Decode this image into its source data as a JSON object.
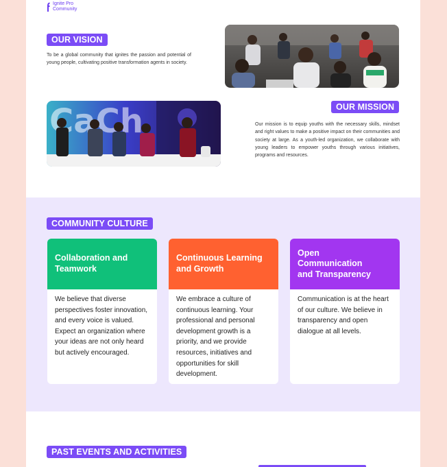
{
  "brand": {
    "line1": "Ignite Pro",
    "line2": "Community",
    "color": "#6b3df0"
  },
  "vision": {
    "label": "OUR VISION",
    "text": "To be a global community that ignites the passion and potential of young people, cultivating positive transformation agents in society."
  },
  "mission": {
    "label": "OUR MISSION",
    "text": "Our mission is to equip youths with the necessary skills, mindset and right values to make a positive impact on their communities and society at large. As a youth-led organization, we collaborate with young leaders to empower youths through various initiatives, programs and resources."
  },
  "culture": {
    "label": "COMMUNITY CULTURE",
    "cards": [
      {
        "title": "Collaboration and Teamwork",
        "body": "We believe that diverse perspectives foster innovation, and every voice is valued. Expect an organization where your ideas are not only heard but actively encouraged.",
        "color": "#10c07a"
      },
      {
        "title": "Continuous Learning and Growth",
        "body": "We embrace a culture of continuous learning. Your professional and personal development growth is a priority, and we provide resources, initiatives and opportunities for skill development.",
        "color": "#ff6130"
      },
      {
        "title": "Open Communication and Transparency",
        "body": "Communication is at the heart of our culture. We believe in transparency and open dialogue at all levels.",
        "color": "#a236f0"
      }
    ]
  },
  "events": {
    "label": "PAST EVENTS AND ACTIVITIES"
  },
  "colors": {
    "accent": "#7b4cf6",
    "band": "#ede7fd",
    "outer": "#fbe0d8"
  }
}
